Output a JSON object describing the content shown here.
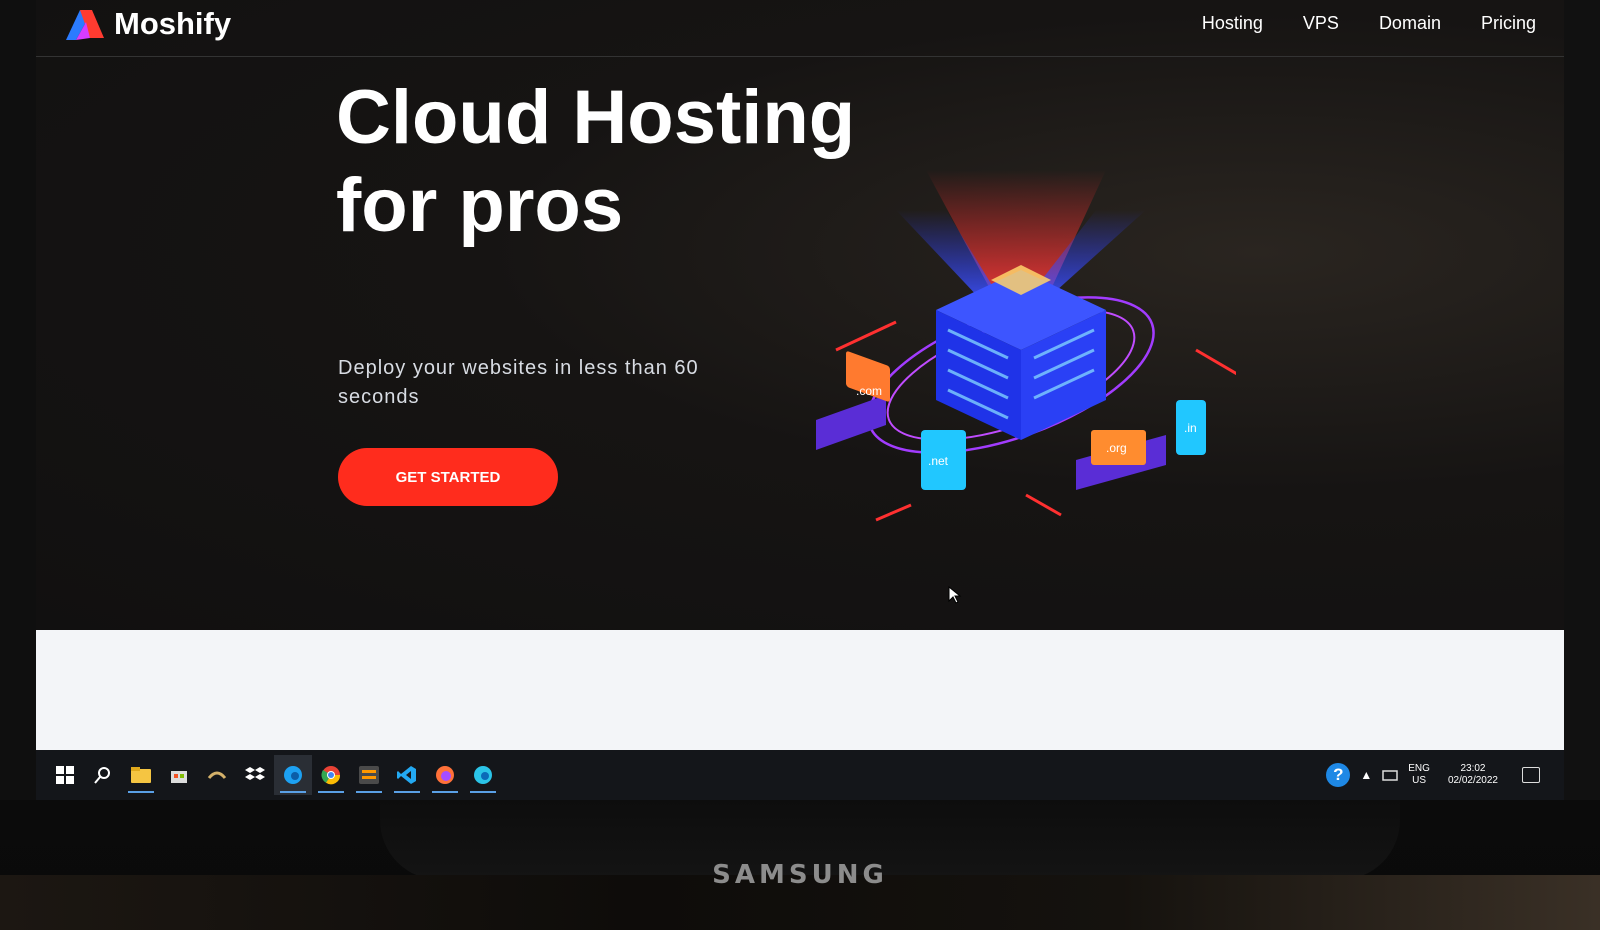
{
  "site": {
    "brand": "Moshify",
    "nav": [
      "Hosting",
      "VPS",
      "Domain",
      "Pricing"
    ],
    "headline": "Cloud Hosting for pros",
    "subtitle": "Deploy your websites in less than 60 seconds",
    "cta_label": "GET STARTED",
    "illustration_labels": [
      ".com",
      ".net",
      ".org",
      ".in"
    ],
    "colors": {
      "accent": "#ff2c1d",
      "hero_bg": "#151312",
      "text": "#ffffff"
    }
  },
  "taskbar": {
    "icons": [
      "windows-start-icon",
      "search-icon",
      "file-explorer-icon",
      "store-icon",
      "cortana-icon",
      "dropbox-icon",
      "edge-icon",
      "chrome-icon",
      "sublime-text-icon",
      "vscode-icon",
      "firefox-icon",
      "edge-icon"
    ],
    "tray": {
      "language": "ENG",
      "region": "US",
      "time": "23:02",
      "date": "02/02/2022"
    }
  },
  "monitor": {
    "brand": "SAMSUNG"
  }
}
